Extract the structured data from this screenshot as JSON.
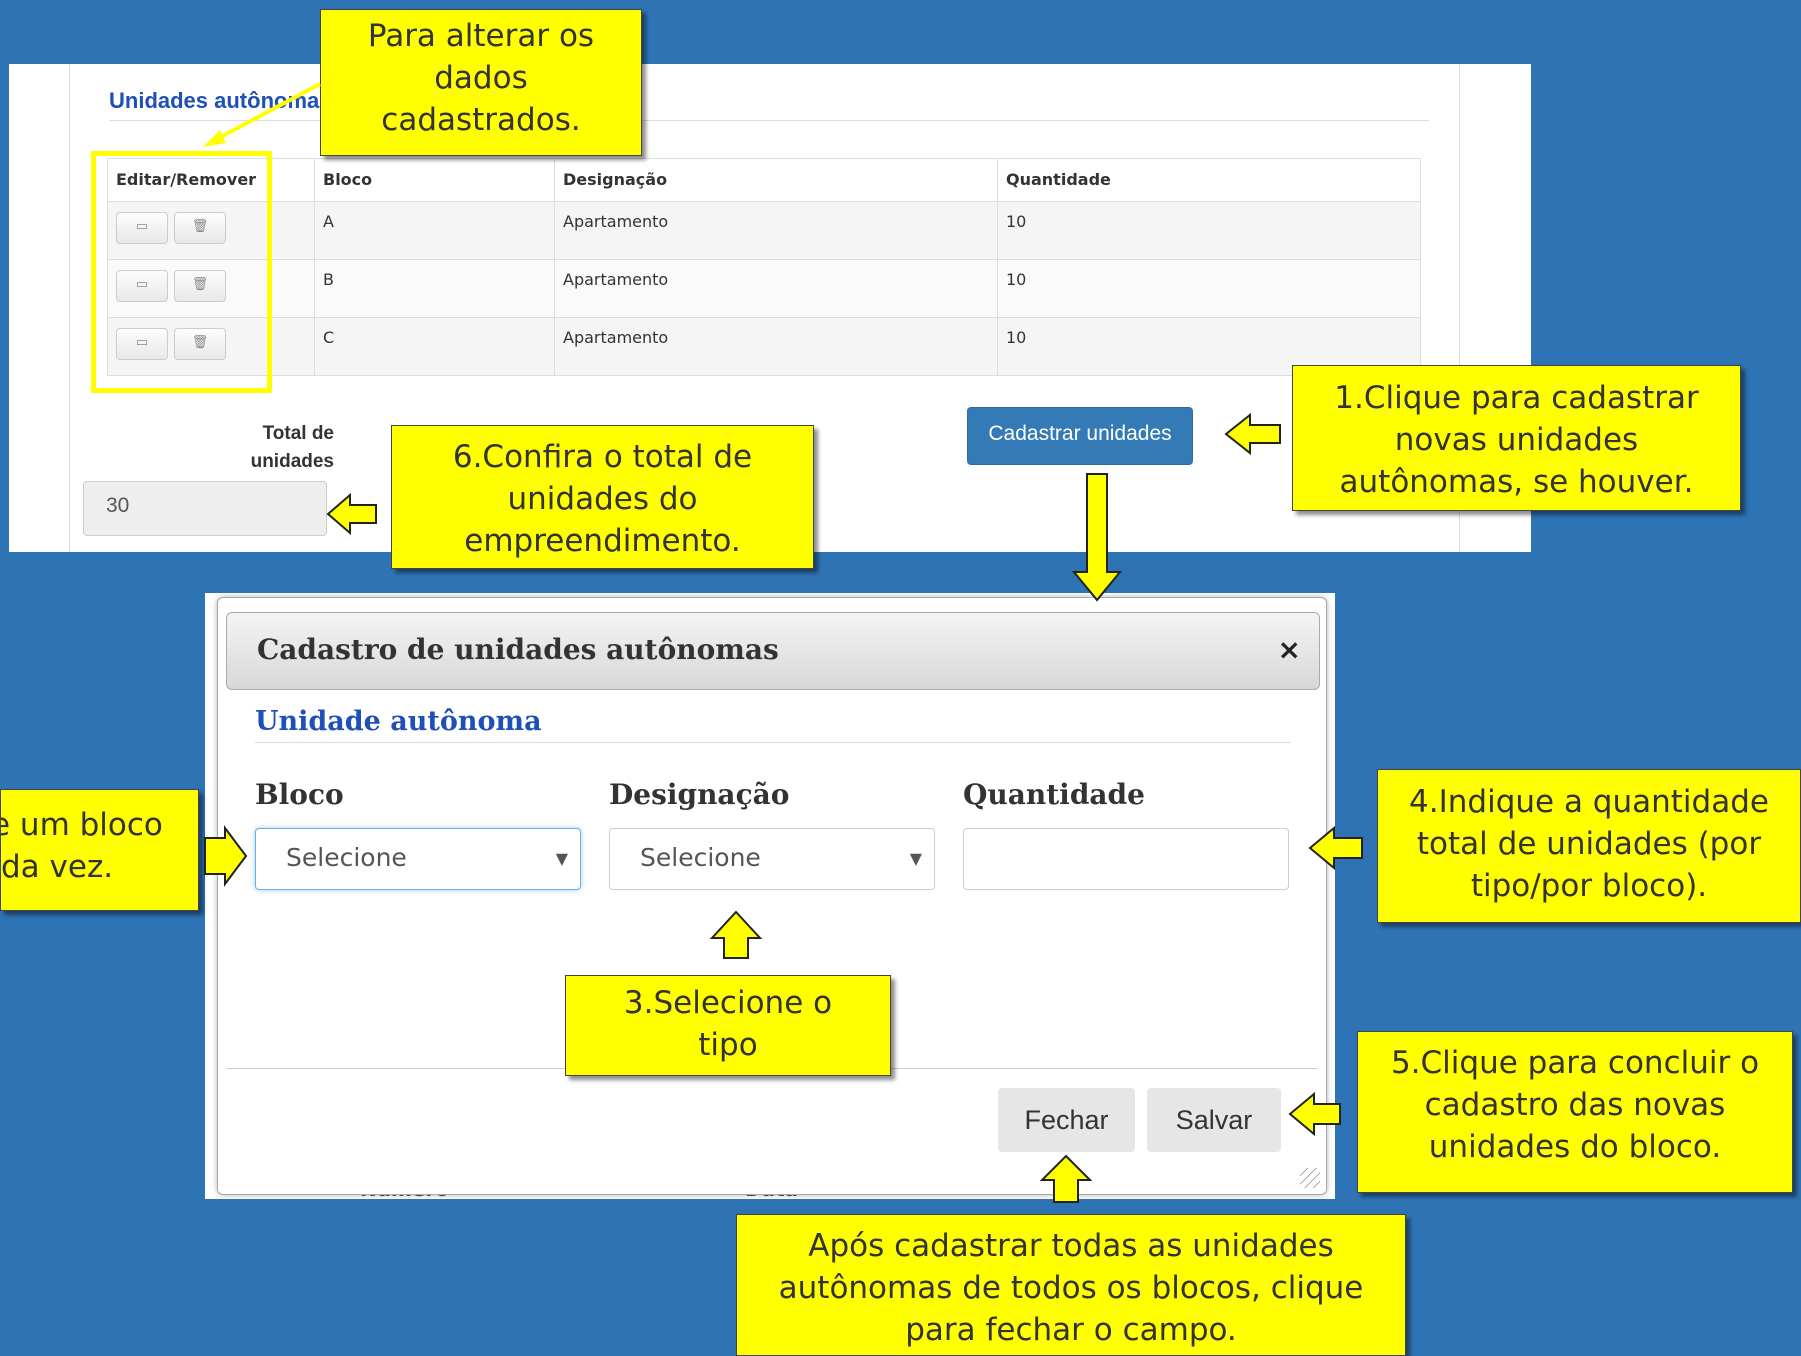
{
  "table_section": {
    "title": "Unidades autônomas",
    "columns": [
      "Editar/Remover",
      "Bloco",
      "Designação",
      "Quantidade"
    ],
    "rows": [
      {
        "bloco": "A",
        "designacao": "Apartamento",
        "quantidade": "10"
      },
      {
        "bloco": "B",
        "designacao": "Apartamento",
        "quantidade": "10"
      },
      {
        "bloco": "C",
        "designacao": "Apartamento",
        "quantidade": "10"
      }
    ],
    "row_icons": [
      "edit-icon",
      "trash-icon"
    ],
    "total_label": "Total de unidades",
    "total_value": "30",
    "register_button": "Cadastrar unidades"
  },
  "modal": {
    "title": "Cadastro de unidades autônomas",
    "close_symbol": "×",
    "subtitle": "Unidade autônoma",
    "fields": {
      "bloco": {
        "label": "Bloco",
        "value": "Selecione"
      },
      "designacao": {
        "label": "Designação",
        "value": "Selecione"
      },
      "quantidade": {
        "label": "Quantidade",
        "value": ""
      }
    },
    "close_button": "Fechar",
    "save_button": "Salvar",
    "background_fragments": [
      "Número",
      "Data"
    ]
  },
  "callouts": {
    "edit_data": "Para alterar os dados cadastrados.",
    "step1": "1.Clique para cadastrar novas unidades autônomas, se houver.",
    "step2_fragment": "e um bloco da vez.",
    "step3": "3.Selecione o tipo",
    "step4": "4.Indique a quantidade total de unidades (por tipo/por bloco).",
    "step5": "5.Clique para concluir o cadastro das novas unidades do bloco.",
    "step6": "6.Confira o total de unidades do empreendimento.",
    "close_hint": "Após cadastrar todas as unidades autônomas de todos os blocos, clique para fechar o campo."
  },
  "colors": {
    "background": "#2e74b5",
    "callout": "#ffff00",
    "link_blue": "#1f4fb8",
    "primary_button": "#337ab7"
  }
}
